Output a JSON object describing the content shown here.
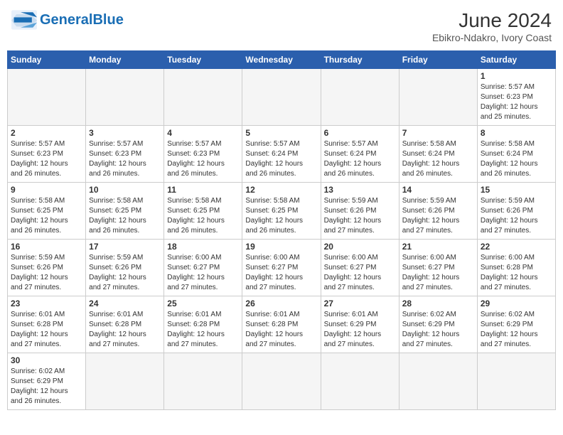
{
  "logo": {
    "text_general": "General",
    "text_blue": "Blue"
  },
  "title": "June 2024",
  "subtitle": "Ebikro-Ndakro, Ivory Coast",
  "weekdays": [
    "Sunday",
    "Monday",
    "Tuesday",
    "Wednesday",
    "Thursday",
    "Friday",
    "Saturday"
  ],
  "weeks": [
    [
      {
        "day": "",
        "info": ""
      },
      {
        "day": "",
        "info": ""
      },
      {
        "day": "",
        "info": ""
      },
      {
        "day": "",
        "info": ""
      },
      {
        "day": "",
        "info": ""
      },
      {
        "day": "",
        "info": ""
      },
      {
        "day": "1",
        "info": "Sunrise: 5:57 AM\nSunset: 6:23 PM\nDaylight: 12 hours\nand 25 minutes."
      }
    ],
    [
      {
        "day": "2",
        "info": "Sunrise: 5:57 AM\nSunset: 6:23 PM\nDaylight: 12 hours\nand 26 minutes."
      },
      {
        "day": "3",
        "info": "Sunrise: 5:57 AM\nSunset: 6:23 PM\nDaylight: 12 hours\nand 26 minutes."
      },
      {
        "day": "4",
        "info": "Sunrise: 5:57 AM\nSunset: 6:23 PM\nDaylight: 12 hours\nand 26 minutes."
      },
      {
        "day": "5",
        "info": "Sunrise: 5:57 AM\nSunset: 6:24 PM\nDaylight: 12 hours\nand 26 minutes."
      },
      {
        "day": "6",
        "info": "Sunrise: 5:57 AM\nSunset: 6:24 PM\nDaylight: 12 hours\nand 26 minutes."
      },
      {
        "day": "7",
        "info": "Sunrise: 5:58 AM\nSunset: 6:24 PM\nDaylight: 12 hours\nand 26 minutes."
      },
      {
        "day": "8",
        "info": "Sunrise: 5:58 AM\nSunset: 6:24 PM\nDaylight: 12 hours\nand 26 minutes."
      }
    ],
    [
      {
        "day": "9",
        "info": "Sunrise: 5:58 AM\nSunset: 6:25 PM\nDaylight: 12 hours\nand 26 minutes."
      },
      {
        "day": "10",
        "info": "Sunrise: 5:58 AM\nSunset: 6:25 PM\nDaylight: 12 hours\nand 26 minutes."
      },
      {
        "day": "11",
        "info": "Sunrise: 5:58 AM\nSunset: 6:25 PM\nDaylight: 12 hours\nand 26 minutes."
      },
      {
        "day": "12",
        "info": "Sunrise: 5:58 AM\nSunset: 6:25 PM\nDaylight: 12 hours\nand 26 minutes."
      },
      {
        "day": "13",
        "info": "Sunrise: 5:59 AM\nSunset: 6:26 PM\nDaylight: 12 hours\nand 27 minutes."
      },
      {
        "day": "14",
        "info": "Sunrise: 5:59 AM\nSunset: 6:26 PM\nDaylight: 12 hours\nand 27 minutes."
      },
      {
        "day": "15",
        "info": "Sunrise: 5:59 AM\nSunset: 6:26 PM\nDaylight: 12 hours\nand 27 minutes."
      }
    ],
    [
      {
        "day": "16",
        "info": "Sunrise: 5:59 AM\nSunset: 6:26 PM\nDaylight: 12 hours\nand 27 minutes."
      },
      {
        "day": "17",
        "info": "Sunrise: 5:59 AM\nSunset: 6:26 PM\nDaylight: 12 hours\nand 27 minutes."
      },
      {
        "day": "18",
        "info": "Sunrise: 6:00 AM\nSunset: 6:27 PM\nDaylight: 12 hours\nand 27 minutes."
      },
      {
        "day": "19",
        "info": "Sunrise: 6:00 AM\nSunset: 6:27 PM\nDaylight: 12 hours\nand 27 minutes."
      },
      {
        "day": "20",
        "info": "Sunrise: 6:00 AM\nSunset: 6:27 PM\nDaylight: 12 hours\nand 27 minutes."
      },
      {
        "day": "21",
        "info": "Sunrise: 6:00 AM\nSunset: 6:27 PM\nDaylight: 12 hours\nand 27 minutes."
      },
      {
        "day": "22",
        "info": "Sunrise: 6:00 AM\nSunset: 6:28 PM\nDaylight: 12 hours\nand 27 minutes."
      }
    ],
    [
      {
        "day": "23",
        "info": "Sunrise: 6:01 AM\nSunset: 6:28 PM\nDaylight: 12 hours\nand 27 minutes."
      },
      {
        "day": "24",
        "info": "Sunrise: 6:01 AM\nSunset: 6:28 PM\nDaylight: 12 hours\nand 27 minutes."
      },
      {
        "day": "25",
        "info": "Sunrise: 6:01 AM\nSunset: 6:28 PM\nDaylight: 12 hours\nand 27 minutes."
      },
      {
        "day": "26",
        "info": "Sunrise: 6:01 AM\nSunset: 6:28 PM\nDaylight: 12 hours\nand 27 minutes."
      },
      {
        "day": "27",
        "info": "Sunrise: 6:01 AM\nSunset: 6:29 PM\nDaylight: 12 hours\nand 27 minutes."
      },
      {
        "day": "28",
        "info": "Sunrise: 6:02 AM\nSunset: 6:29 PM\nDaylight: 12 hours\nand 27 minutes."
      },
      {
        "day": "29",
        "info": "Sunrise: 6:02 AM\nSunset: 6:29 PM\nDaylight: 12 hours\nand 27 minutes."
      }
    ],
    [
      {
        "day": "30",
        "info": "Sunrise: 6:02 AM\nSunset: 6:29 PM\nDaylight: 12 hours\nand 26 minutes."
      },
      {
        "day": "",
        "info": ""
      },
      {
        "day": "",
        "info": ""
      },
      {
        "day": "",
        "info": ""
      },
      {
        "day": "",
        "info": ""
      },
      {
        "day": "",
        "info": ""
      },
      {
        "day": "",
        "info": ""
      }
    ]
  ]
}
